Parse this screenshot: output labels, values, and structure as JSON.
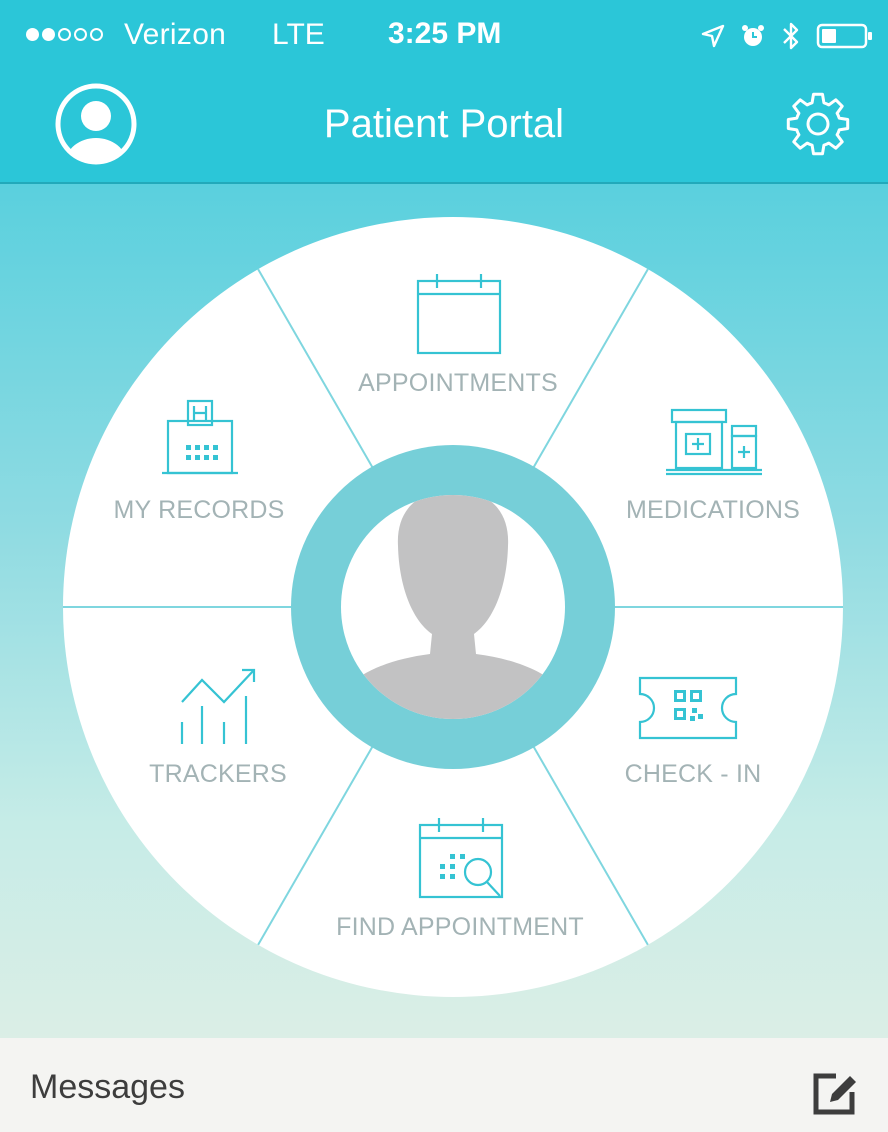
{
  "status_bar": {
    "carrier": "Verizon",
    "network": "LTE",
    "time": "3:25 PM",
    "signal_bars_filled": 2,
    "signal_bars_total": 5,
    "battery_level": 0.35,
    "icons": [
      "location-arrow-icon",
      "alarm-icon",
      "bluetooth-icon",
      "battery-icon"
    ]
  },
  "header": {
    "title": "Patient Portal",
    "left_icon": "profile-avatar-icon",
    "right_icon": "gear-icon"
  },
  "menu": {
    "items": [
      {
        "label": "APPOINTMENTS",
        "icon": "calendar-icon"
      },
      {
        "label": "MEDICATIONS",
        "icon": "medication-bottles-icon"
      },
      {
        "label": "CHECK - IN",
        "icon": "qr-ticket-icon"
      },
      {
        "label": "FIND APPOINTMENT",
        "icon": "calendar-search-icon"
      },
      {
        "label": "TRACKERS",
        "icon": "trend-chart-icon"
      },
      {
        "label": "MY RECORDS",
        "icon": "hospital-building-icon"
      }
    ],
    "center_icon": "user-silhouette-icon"
  },
  "footer": {
    "messages_label": "Messages",
    "compose_icon": "compose-icon"
  },
  "colors": {
    "brand": "#2bc6d8",
    "accent_line": "#35c3d3",
    "label_gray": "#a3b3b5",
    "ring": "#76cfd8"
  }
}
